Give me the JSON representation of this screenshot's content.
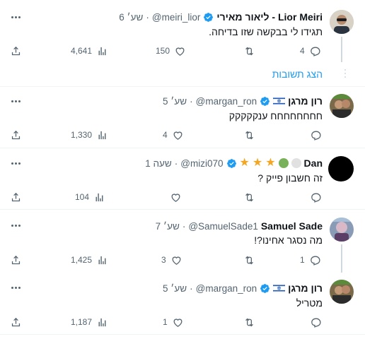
{
  "tweets": [
    {
      "name": "ליאור מאירי - Lior Meiri",
      "handle": "@meiri_lior",
      "time": "6 שע׳",
      "text": "תגידו לי בבקשה שזו בדיחה.",
      "replies": "4",
      "retweets": "",
      "likes": "150",
      "views": "4,641",
      "show_replies": "הצג תשובות"
    },
    {
      "name": "רון מרגן",
      "handle": "@margan_ron",
      "time": "5 שע׳",
      "text": "חחחחחחחח ענקקקקק",
      "replies": "",
      "retweets": "",
      "likes": "4",
      "views": "1,330"
    },
    {
      "name": "Dan",
      "handle": "@mizi070",
      "time": "שעה 1",
      "text": "זה חשבון פייק ?",
      "replies": "",
      "retweets": "",
      "likes": "",
      "views": "104"
    },
    {
      "name": "Samuel Sade",
      "handle": "@SamuelSade1",
      "time": "7 שע׳",
      "text": "מה נסגר אחינו?!",
      "replies": "1",
      "retweets": "",
      "likes": "3",
      "views": "1,425"
    },
    {
      "name": "רון מרגן",
      "handle": "@margan_ron",
      "time": "5 שע׳",
      "text": "מטריל",
      "replies": "",
      "retweets": "",
      "likes": "1",
      "views": "1,187"
    }
  ],
  "colors": {
    "accent": "#1d9bf0",
    "muted": "#536471",
    "star": "#f4a623"
  },
  "icons": [
    "reply-icon",
    "retweet-icon",
    "like-icon",
    "views-icon",
    "share-icon",
    "verified-icon",
    "more-icon",
    "israel-flag-icon",
    "star-icon"
  ]
}
